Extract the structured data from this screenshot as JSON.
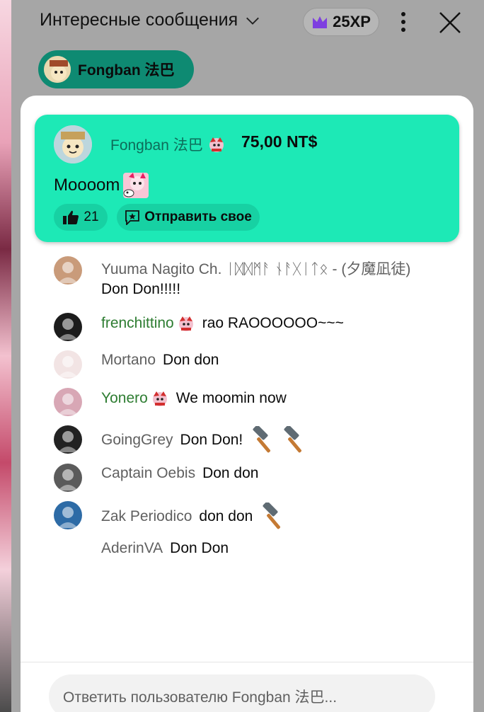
{
  "header": {
    "title": "Интересные сообщения",
    "xp": "25XP"
  },
  "filter_chip": {
    "label": "Fongban 法巴"
  },
  "super_chat": {
    "author": "Fongban 法巴",
    "amount": "75,00 NT$",
    "message": "Moooom",
    "likes": "21",
    "send_label": "Отправить свое",
    "color": "#1de9b6"
  },
  "chat": [
    {
      "author": "Yuuma Nagito Ch. ᛁᛞᛞᛗᚨ ᚾᚨᚷᛁᛏᛟ - (夕魔凪徒)",
      "message": "Don Don!!!!!",
      "member": false,
      "badge": false,
      "hammers": 0
    },
    {
      "author": "frenchittino",
      "message": "rao RAOOOOOO~~~",
      "member": true,
      "badge": true,
      "hammers": 0
    },
    {
      "author": "Mortano",
      "message": "Don don",
      "member": false,
      "badge": false,
      "hammers": 0
    },
    {
      "author": "Yonero",
      "message": "We moomin now",
      "member": true,
      "badge": true,
      "hammers": 0
    },
    {
      "author": "GoingGrey",
      "message": "Don Don!",
      "member": false,
      "badge": false,
      "hammers": 2
    },
    {
      "author": "Captain Oebis",
      "message": "Don don",
      "member": false,
      "badge": false,
      "hammers": 0
    },
    {
      "author": "Zak Periodico",
      "message": "don don",
      "member": false,
      "badge": false,
      "hammers": 1
    },
    {
      "author": "AderinVA",
      "message": "Don Don",
      "member": false,
      "badge": false,
      "hammers": 0
    }
  ],
  "reply": {
    "placeholder": "Ответить пользователю Fongban 法巴..."
  },
  "icons": {
    "chevron": "chevron-down-icon",
    "crown": "crown-icon",
    "kebab": "more-vert-icon",
    "close": "close-icon",
    "like": "thumbs-up-icon",
    "send": "sticker-icon",
    "hammer": "hammer-icon"
  }
}
